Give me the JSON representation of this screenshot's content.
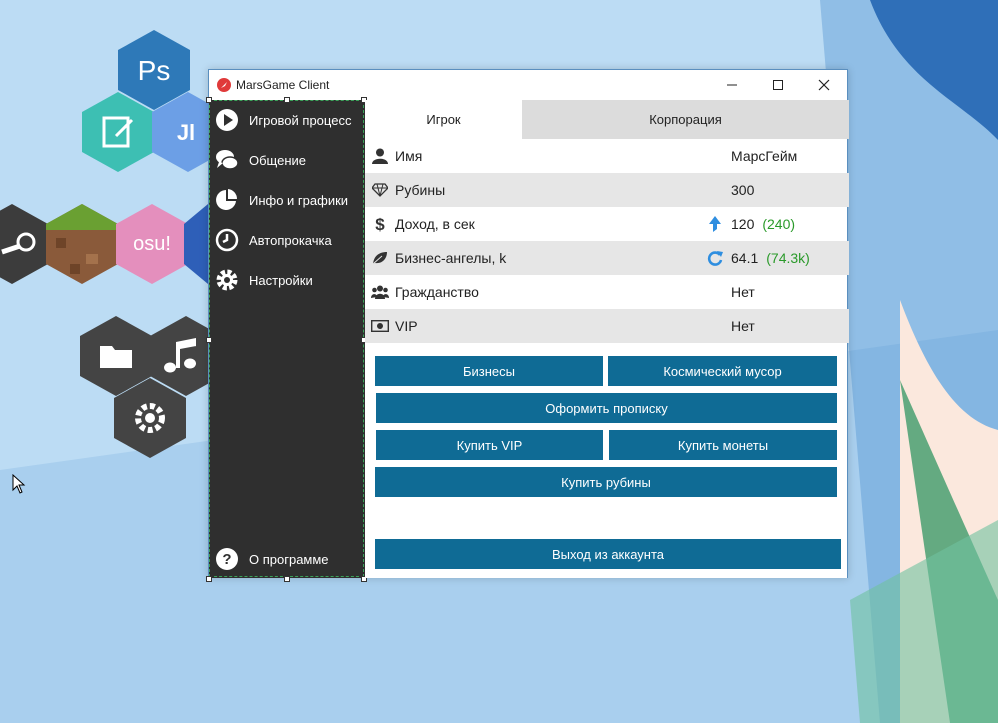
{
  "window": {
    "title": "MarsGame Client",
    "controls": {
      "minimize": "—",
      "maximize": "☐",
      "close": "✕"
    }
  },
  "sidebar": {
    "items": [
      {
        "label": "Игровой процесс",
        "icon": "play-icon"
      },
      {
        "label": "Общение",
        "icon": "chat-icon"
      },
      {
        "label": "Инфо и графики",
        "icon": "pie-chart-icon"
      },
      {
        "label": "Автопрокачка",
        "icon": "clock-icon"
      },
      {
        "label": "Настройки",
        "icon": "gear-icon"
      }
    ],
    "about": {
      "label": "О программе",
      "icon": "question-icon"
    }
  },
  "tabs": [
    {
      "label": "Игрок",
      "active": true
    },
    {
      "label": "Корпорация",
      "active": false
    }
  ],
  "stats": [
    {
      "label": "Имя",
      "value": "МарсГейм",
      "extra": "",
      "icon": "user-icon"
    },
    {
      "label": "Рубины",
      "value": "300",
      "extra": "",
      "icon": "diamond-icon"
    },
    {
      "label": "Доход, в сек",
      "value": "120",
      "extra": "(240)",
      "icon": "dollar-icon",
      "indicator": "arrow-up-icon"
    },
    {
      "label": "Бизнес-ангелы, k",
      "value": "64.1",
      "extra": "(74.3k)",
      "icon": "leaf-icon",
      "indicator": "refresh-icon"
    },
    {
      "label": "Гражданство",
      "value": "Нет",
      "extra": "",
      "icon": "users-icon"
    },
    {
      "label": "VIP",
      "value": "Нет",
      "extra": "",
      "icon": "money-icon"
    }
  ],
  "buttons": {
    "businesses": "Бизнесы",
    "space_junk": "Космический мусор",
    "register": "Оформить прописку",
    "buy_vip": "Купить VIP",
    "buy_coins": "Купить монеты",
    "buy_rubies": "Купить рубины",
    "logout": "Выход из аккаунта"
  },
  "desktop_icons": [
    {
      "label": "Ps",
      "icon": "photoshop-icon"
    },
    {
      "label": "",
      "icon": "document-edit-icon"
    },
    {
      "label": "Jl",
      "icon": "jl-app-icon"
    },
    {
      "label": "",
      "icon": "steam-icon"
    },
    {
      "label": "",
      "icon": "minecraft-grass-icon"
    },
    {
      "label": "osu!",
      "icon": "osu-icon"
    },
    {
      "label": "",
      "icon": "folder-icon"
    },
    {
      "label": "",
      "icon": "music-note-icon"
    },
    {
      "label": "",
      "icon": "settings-gear-icon"
    }
  ],
  "colors": {
    "accent_button": "#0f6b95",
    "sidebar_bg": "#2f2f2f",
    "extra_value": "#2a9a2a",
    "desktop_bg": "#bcdcf4"
  }
}
